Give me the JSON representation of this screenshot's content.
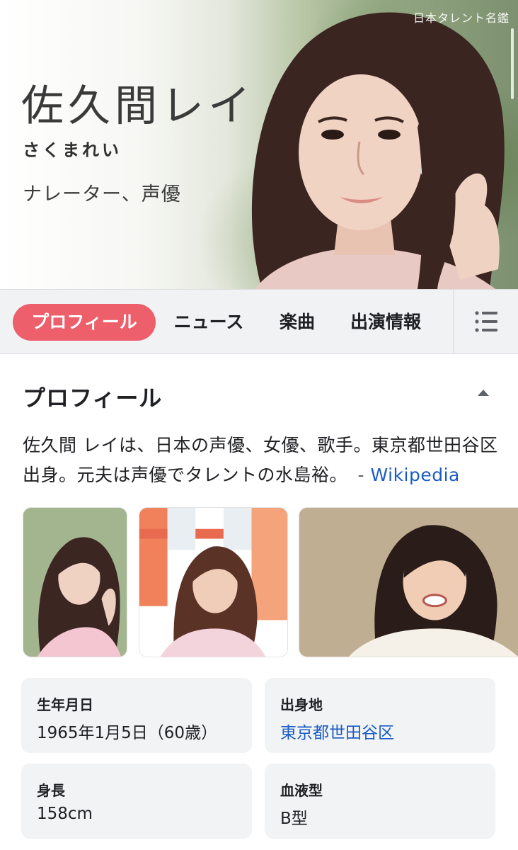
{
  "hero": {
    "name": "佐久間レイ",
    "reading": "さくまれい",
    "occupation": "ナレーター、声優",
    "credit": "日本タレント名鑑"
  },
  "tabs": [
    {
      "label": "プロフィール",
      "active": true
    },
    {
      "label": "ニュース",
      "active": false
    },
    {
      "label": "楽曲",
      "active": false
    },
    {
      "label": "出演情報",
      "active": false
    }
  ],
  "menu_icon": "list-icon",
  "profile": {
    "title": "プロフィール",
    "collapse_icon": "triangle-up-icon",
    "description": "佐久間 レイは、日本の声優、女優、歌手。東京都世田谷区出身。元夫は声優でタレントの水島裕。",
    "source_separator": "-",
    "source_link": "Wikipedia"
  },
  "facts": [
    {
      "label": "生年月日",
      "value": "1965年1月5日（60歳）",
      "is_link": false
    },
    {
      "label": "出身地",
      "value": "東京都世田谷区",
      "is_link": true
    },
    {
      "label": "身長",
      "value": "158cm",
      "is_link": false
    },
    {
      "label": "血液型",
      "value": "B型",
      "is_link": false
    }
  ],
  "colors": {
    "accent": "#ed5f6b",
    "link": "#1a5bc4",
    "card_bg": "#f1f3f4",
    "tab_bg": "#f1f2f4"
  }
}
